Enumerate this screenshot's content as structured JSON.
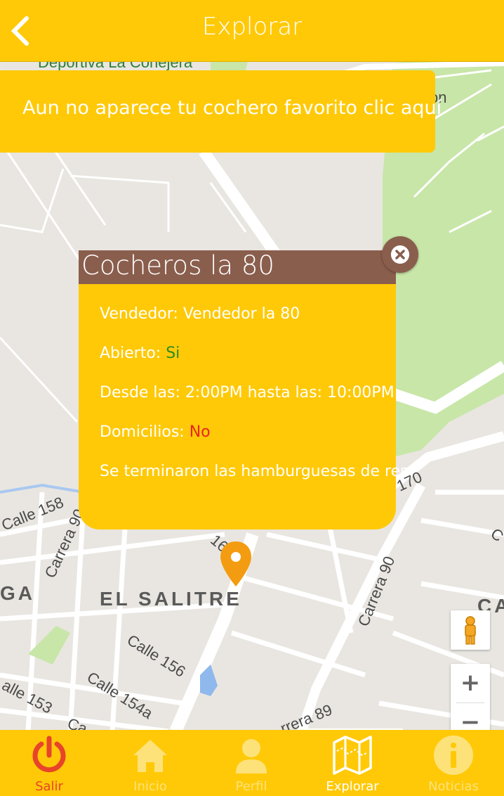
{
  "header": {
    "title": "Explorar"
  },
  "banner": {
    "text": "Aun no aparece tu cochero favorito clic aquí"
  },
  "map": {
    "labels": {
      "park_top": "Deportiva La Conejera",
      "top_right_fragment": "on",
      "calle158": "Calle 158",
      "carrera90a": "Carrera 90",
      "ga": "GA",
      "el_salitre": "EL SALITRE",
      "calle156": "Calle 156",
      "calle154a": "Calle 154a",
      "calle153": "alle 153",
      "carrera90b": "Carrera 90",
      "carrera89": "rrera 89",
      "ca": "CA",
      "c170": "170",
      "c16": "16",
      "ca2": "Ca",
      "c_right": "C"
    },
    "pin_color": "#f39c12"
  },
  "info_window": {
    "title": "Cocheros la 80",
    "vendedor_label": "Vendedor:",
    "vendedor_value": "Vendedor la 80",
    "abierto_label": "Abierto:",
    "abierto_value": "Si",
    "horario_label": "Desde las:",
    "horario_desde": "2:00PM",
    "horario_mid": "hasta las:",
    "horario_hasta": "10:00PM",
    "domicilios_label": "Domicilios:",
    "domicilios_value": "No",
    "nota": "Se terminaron las hamburguesas de res"
  },
  "map_controls": {
    "zoom_in": "+",
    "zoom_out": "−"
  },
  "nav": {
    "items": [
      {
        "label": "Salir",
        "icon": "power-icon"
      },
      {
        "label": "Inicio",
        "icon": "home-icon"
      },
      {
        "label": "Perfil",
        "icon": "user-icon"
      },
      {
        "label": "Explorar",
        "icon": "map-icon"
      },
      {
        "label": "Noticias",
        "icon": "info-icon"
      }
    ]
  },
  "colors": {
    "primary": "#ffc907",
    "brown": "#8a5e4d",
    "green": "#2e8b20",
    "red": "#e8261b"
  }
}
